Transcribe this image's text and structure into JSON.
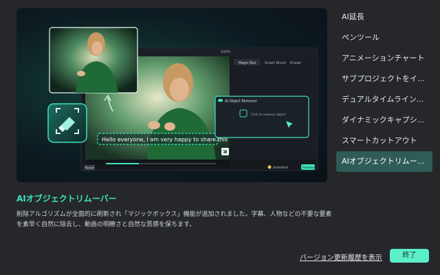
{
  "preview": {
    "caption": "Hello everyone, I am very happy to share this",
    "panel_title": "AI Object Remover",
    "panel_hint": "Click to remove object",
    "tool_magic": "Magic Box",
    "tool_select": "Smart Brush",
    "tool_erase": "Eraser",
    "zoom": "100%",
    "reset_label": "Reset",
    "unlimited_label": "Unlimited",
    "remove_label": "Remove",
    "accent": "#3ee3be"
  },
  "sidebar": {
    "items": [
      {
        "label": "AI延長"
      },
      {
        "label": "ペンツール"
      },
      {
        "label": "アニメーションチャート"
      },
      {
        "label": "サブプロジェクトをイ..."
      },
      {
        "label": "デュアルタイムライン..."
      },
      {
        "label": "ダイナミックキャプシ..."
      },
      {
        "label": "スマートカットアウト"
      },
      {
        "label": "AIオブジェクトリムー..."
      }
    ],
    "active_index": 7
  },
  "feature": {
    "title": "AIオブジェクトリムーバー",
    "description": "削除アルゴリズムが全面的に刷新され「マジックボックス」機能が追加されました。字幕、人物などの不要な要素を素早く自然に除去し、動画の明瞭さと自然な質感を保ちます。"
  },
  "footer": {
    "history_link": "バージョン更新履歴を表示",
    "end_button": "終了"
  }
}
